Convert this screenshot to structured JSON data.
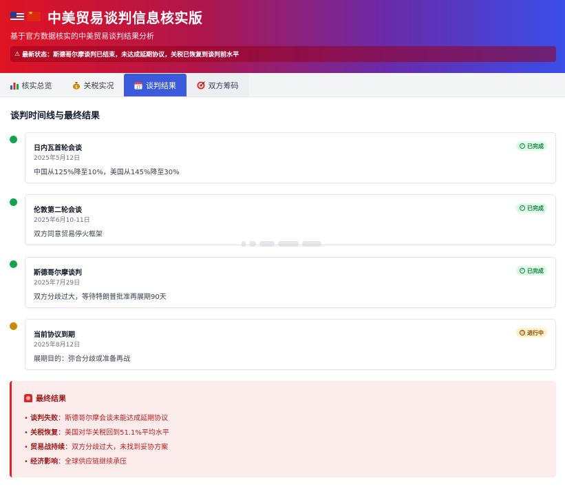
{
  "header": {
    "title": "中美贸易谈判信息核实版",
    "subtitle": "基于官方数据核实的中美贸易谈判结果分析",
    "alert": "最新状态：斯德哥尔摩谈判已结束，未达成延期协议，关税已恢复到谈判前水平",
    "flags": [
      "us-flag-icon",
      "cn-flag-icon"
    ]
  },
  "tabs": [
    {
      "label": "核实总览",
      "icon": "bar-chart-icon"
    },
    {
      "label": "关税实况",
      "icon": "money-bag-icon"
    },
    {
      "label": "谈判结果",
      "icon": "calendar-icon",
      "active": true
    },
    {
      "label": "双方筹码",
      "icon": "target-icon"
    }
  ],
  "section": {
    "title": "谈判时间线与最终结果"
  },
  "timeline": [
    {
      "title": "日内瓦首轮会谈",
      "date": "2025年5月12日",
      "desc": "中国从125%降至10%，美国从145%降至30%",
      "status": "已完成",
      "color": "#16a34a"
    },
    {
      "title": "伦敦第二轮会谈",
      "date": "2025年6月10-11日",
      "desc": "双方同意贸易停火框架",
      "status": "已完成",
      "color": "#16a34a"
    },
    {
      "title": "斯德哥尔摩谈判",
      "date": "2025年7月29日",
      "desc": "双方分歧过大，等待特朗普批准再展期90天",
      "status": "已完成",
      "color": "#16a34a"
    },
    {
      "title": "当前协议到期",
      "date": "2025年8月12日",
      "desc": "展期目的：弥合分歧或准备再战",
      "status": "进行中",
      "color": "#ca8a04"
    }
  ],
  "result": {
    "title": "最终结果",
    "items": [
      {
        "label": "谈判失败",
        "text": "斯德哥尔摩会谈未能达成延期协议"
      },
      {
        "label": "关税恢复",
        "text": "美国对华关税回到51.1%平均水平"
      },
      {
        "label": "贸易战持续",
        "text": "双方分歧过大，未找到妥协方案"
      },
      {
        "label": "经济影响",
        "text": "全球供应链继续承压"
      }
    ]
  },
  "colors": {
    "accent": "#3b5bdb",
    "done": "#16a34a",
    "progress": "#ca8a04",
    "danger": "#dc2626"
  }
}
